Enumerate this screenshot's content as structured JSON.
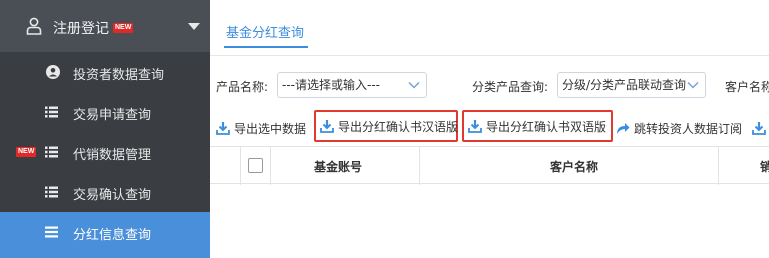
{
  "sidebar": {
    "group": {
      "label": "注册登记",
      "badge": "NEW",
      "icon": "user-icon"
    },
    "items": [
      {
        "label": "投资者数据查询",
        "icon": "user-circle-icon",
        "badge": ""
      },
      {
        "label": "交易申请查询",
        "icon": "list-icon",
        "badge": ""
      },
      {
        "label": "代销数据管理",
        "icon": "list-icon",
        "badge": "NEW"
      },
      {
        "label": "交易确认查询",
        "icon": "list-icon",
        "badge": ""
      },
      {
        "label": "分红信息查询",
        "icon": "list-icon",
        "badge": "",
        "active": true
      }
    ]
  },
  "tabs": [
    {
      "label": "基金分红查询",
      "active": true
    }
  ],
  "filters": {
    "product_label": "产品名称:",
    "product_value": "---请选择或输入---",
    "category_label": "分类产品查询:",
    "category_value": "分级/分类产品联动查询",
    "customer_label": "客户名称"
  },
  "toolbar": {
    "export_selected": "导出选中数据",
    "export_cn": "导出分红确认书汉语版",
    "export_bilingual": "导出分红确认书双语版",
    "jump_subscription": "跳转投资人数据订阅"
  },
  "table": {
    "columns": [
      "基金账号",
      "客户名称",
      "销"
    ]
  },
  "colors": {
    "accent": "#3c8dde",
    "sidebar_bg": "#3a3d42",
    "active_bg": "#4a8fd9",
    "highlight": "#e03a2f",
    "badge": "#e02a2a"
  }
}
